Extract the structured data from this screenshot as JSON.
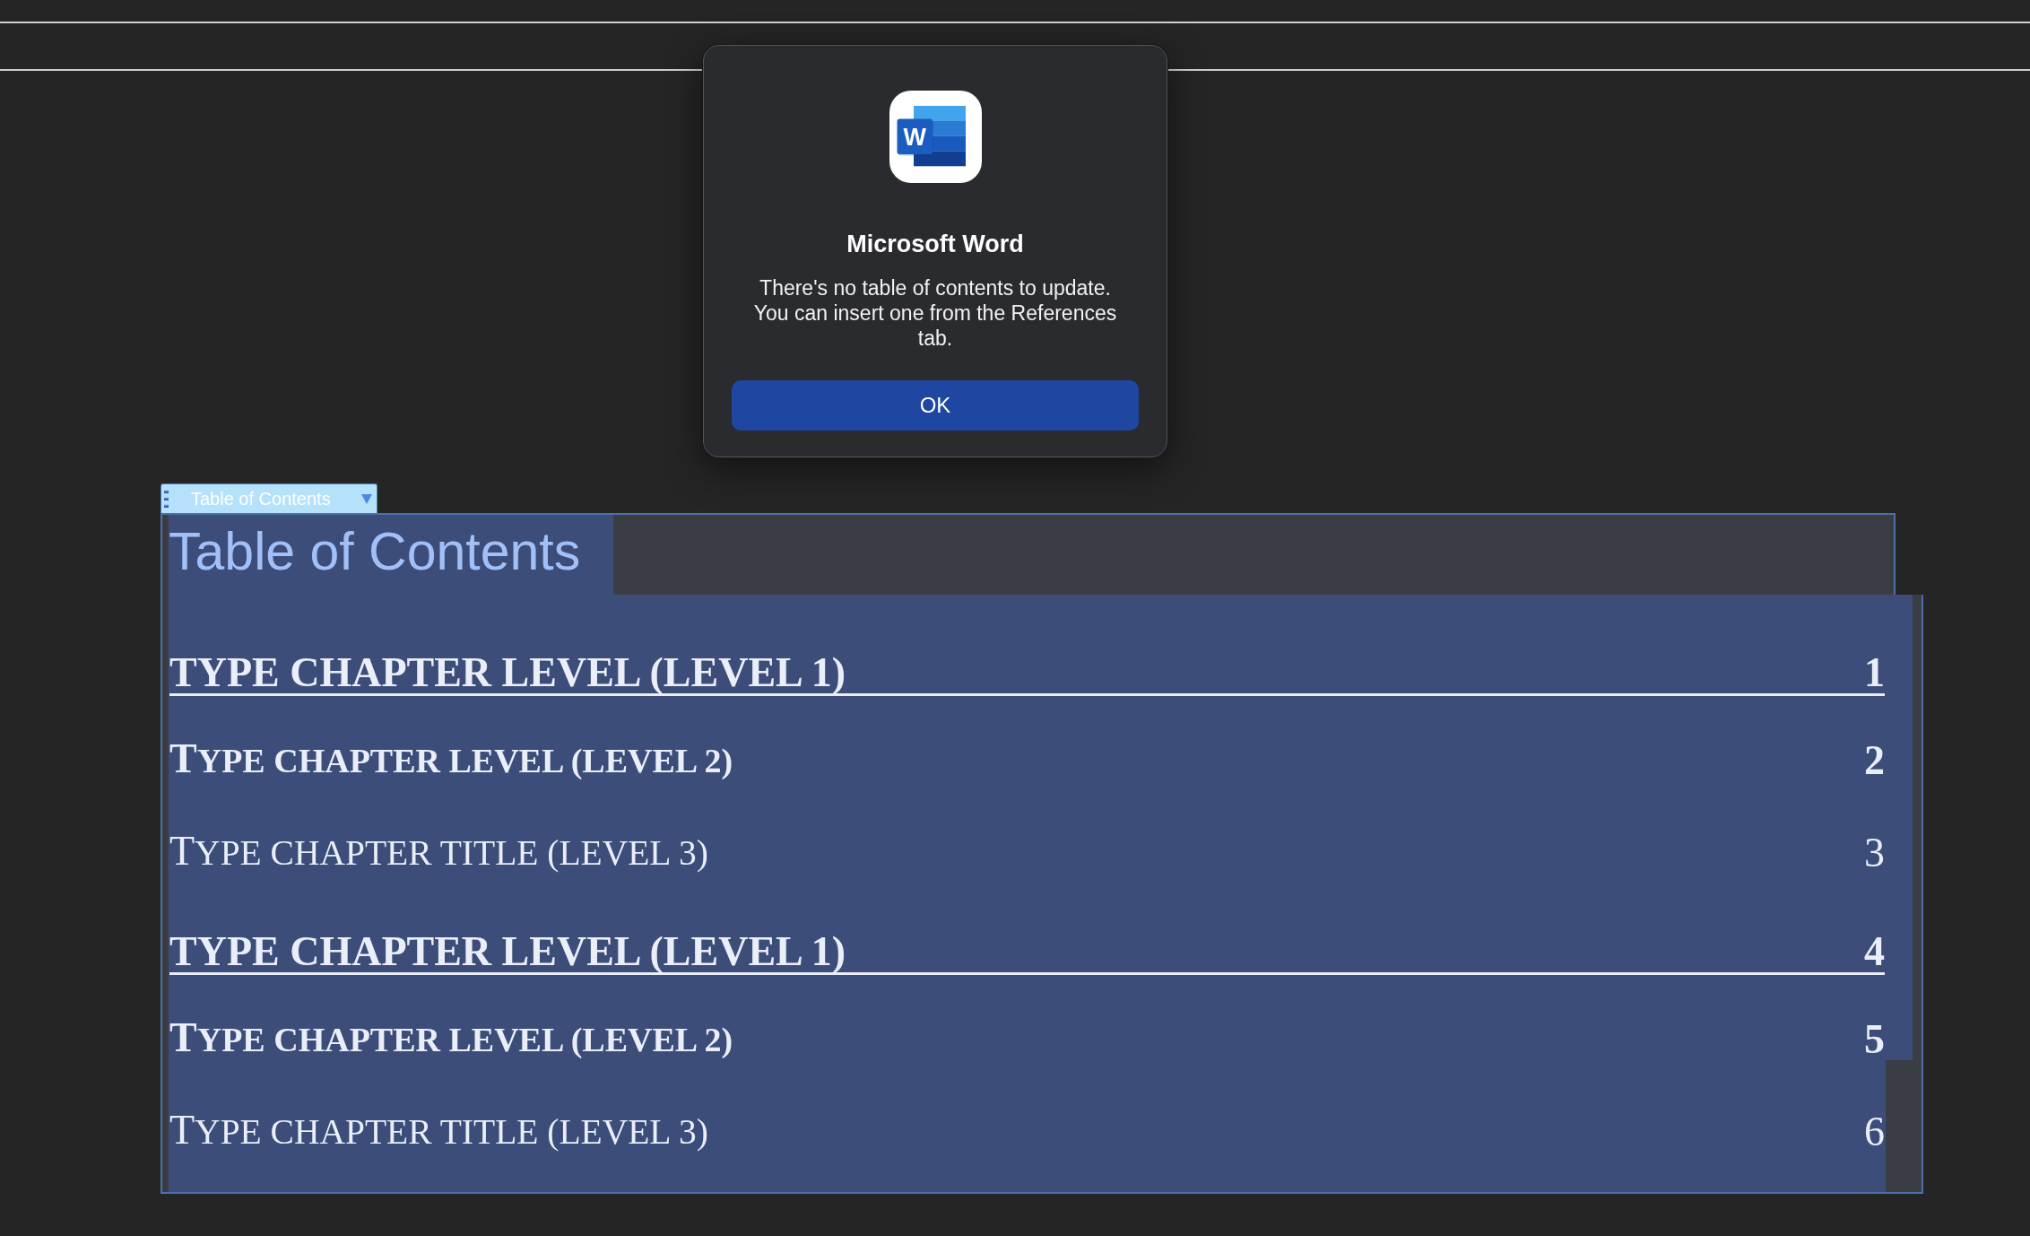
{
  "dialog": {
    "app_icon_letter": "W",
    "title": "Microsoft Word",
    "message": "There's no table of contents to update. You can insert one from the References tab.",
    "buttons": [
      {
        "label": "OK",
        "default": true
      }
    ]
  },
  "document": {
    "content_control": {
      "tag": "Table of Contents",
      "title": "Table of Contents",
      "entries": [
        {
          "text": "TYPE CHAPTER LEVEL (LEVEL 1)",
          "page": "1",
          "children": [
            {
              "text": "TYPE CHAPTER LEVEL (LEVEL 2)",
              "page": "2",
              "children": [
                {
                  "text": "TYPE CHAPTER TITLE (LEVEL 3)",
                  "page": "3"
                }
              ]
            }
          ]
        },
        {
          "text": "TYPE CHAPTER LEVEL (LEVEL 1)",
          "page": "4",
          "children": [
            {
              "text": "TYPE CHAPTER LEVEL (LEVEL 2)",
              "page": "5",
              "children": [
                {
                  "text": "TYPE CHAPTER TITLE (LEVEL 3)",
                  "page": "6"
                }
              ]
            }
          ]
        }
      ]
    }
  }
}
